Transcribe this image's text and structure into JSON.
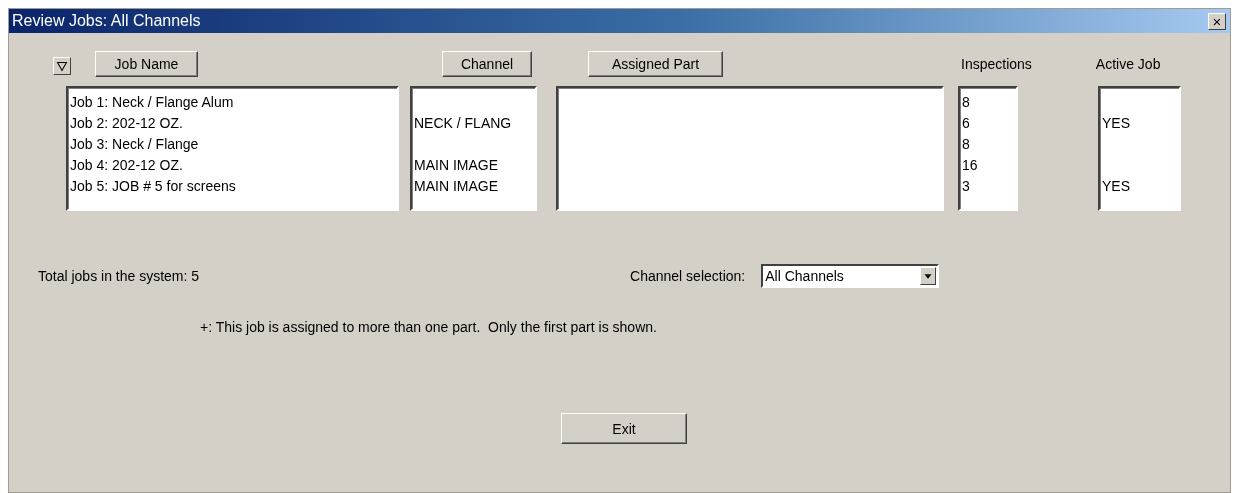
{
  "window": {
    "title": "Review Jobs: All Channels",
    "close": "×"
  },
  "columns": [
    {
      "label": "Job Name",
      "kind": "button"
    },
    {
      "label": "Channel",
      "kind": "button"
    },
    {
      "label": "Assigned Part",
      "kind": "button"
    },
    {
      "label": "Inspections",
      "kind": "label"
    },
    {
      "label": "Active Job",
      "kind": "label"
    }
  ],
  "jobs": [
    {
      "name": "Job 1: Neck / Flange Alum",
      "inspections": "8"
    },
    {
      "name": "Job 2: 202-12 OZ.",
      "channel": "NECK / FLANG",
      "inspections": "6",
      "active_job": "YES"
    },
    {
      "name": "Job 3: Neck / Flange",
      "inspections": "8"
    },
    {
      "name": "Job 4: 202-12 OZ.",
      "channel": "MAIN IMAGE",
      "inspections": "16"
    },
    {
      "name": "Job 5: JOB # 5 for screens",
      "channel": "MAIN IMAGE",
      "inspections": "3",
      "active_job": "YES"
    }
  ],
  "total_jobs": "Total jobs in the system: 5",
  "channel_selection": {
    "label": "Channel selection:",
    "value": "All Channels"
  },
  "note": "+: This job is assigned to more than one part.  Only the first part is shown.",
  "exit_button": "Exit"
}
